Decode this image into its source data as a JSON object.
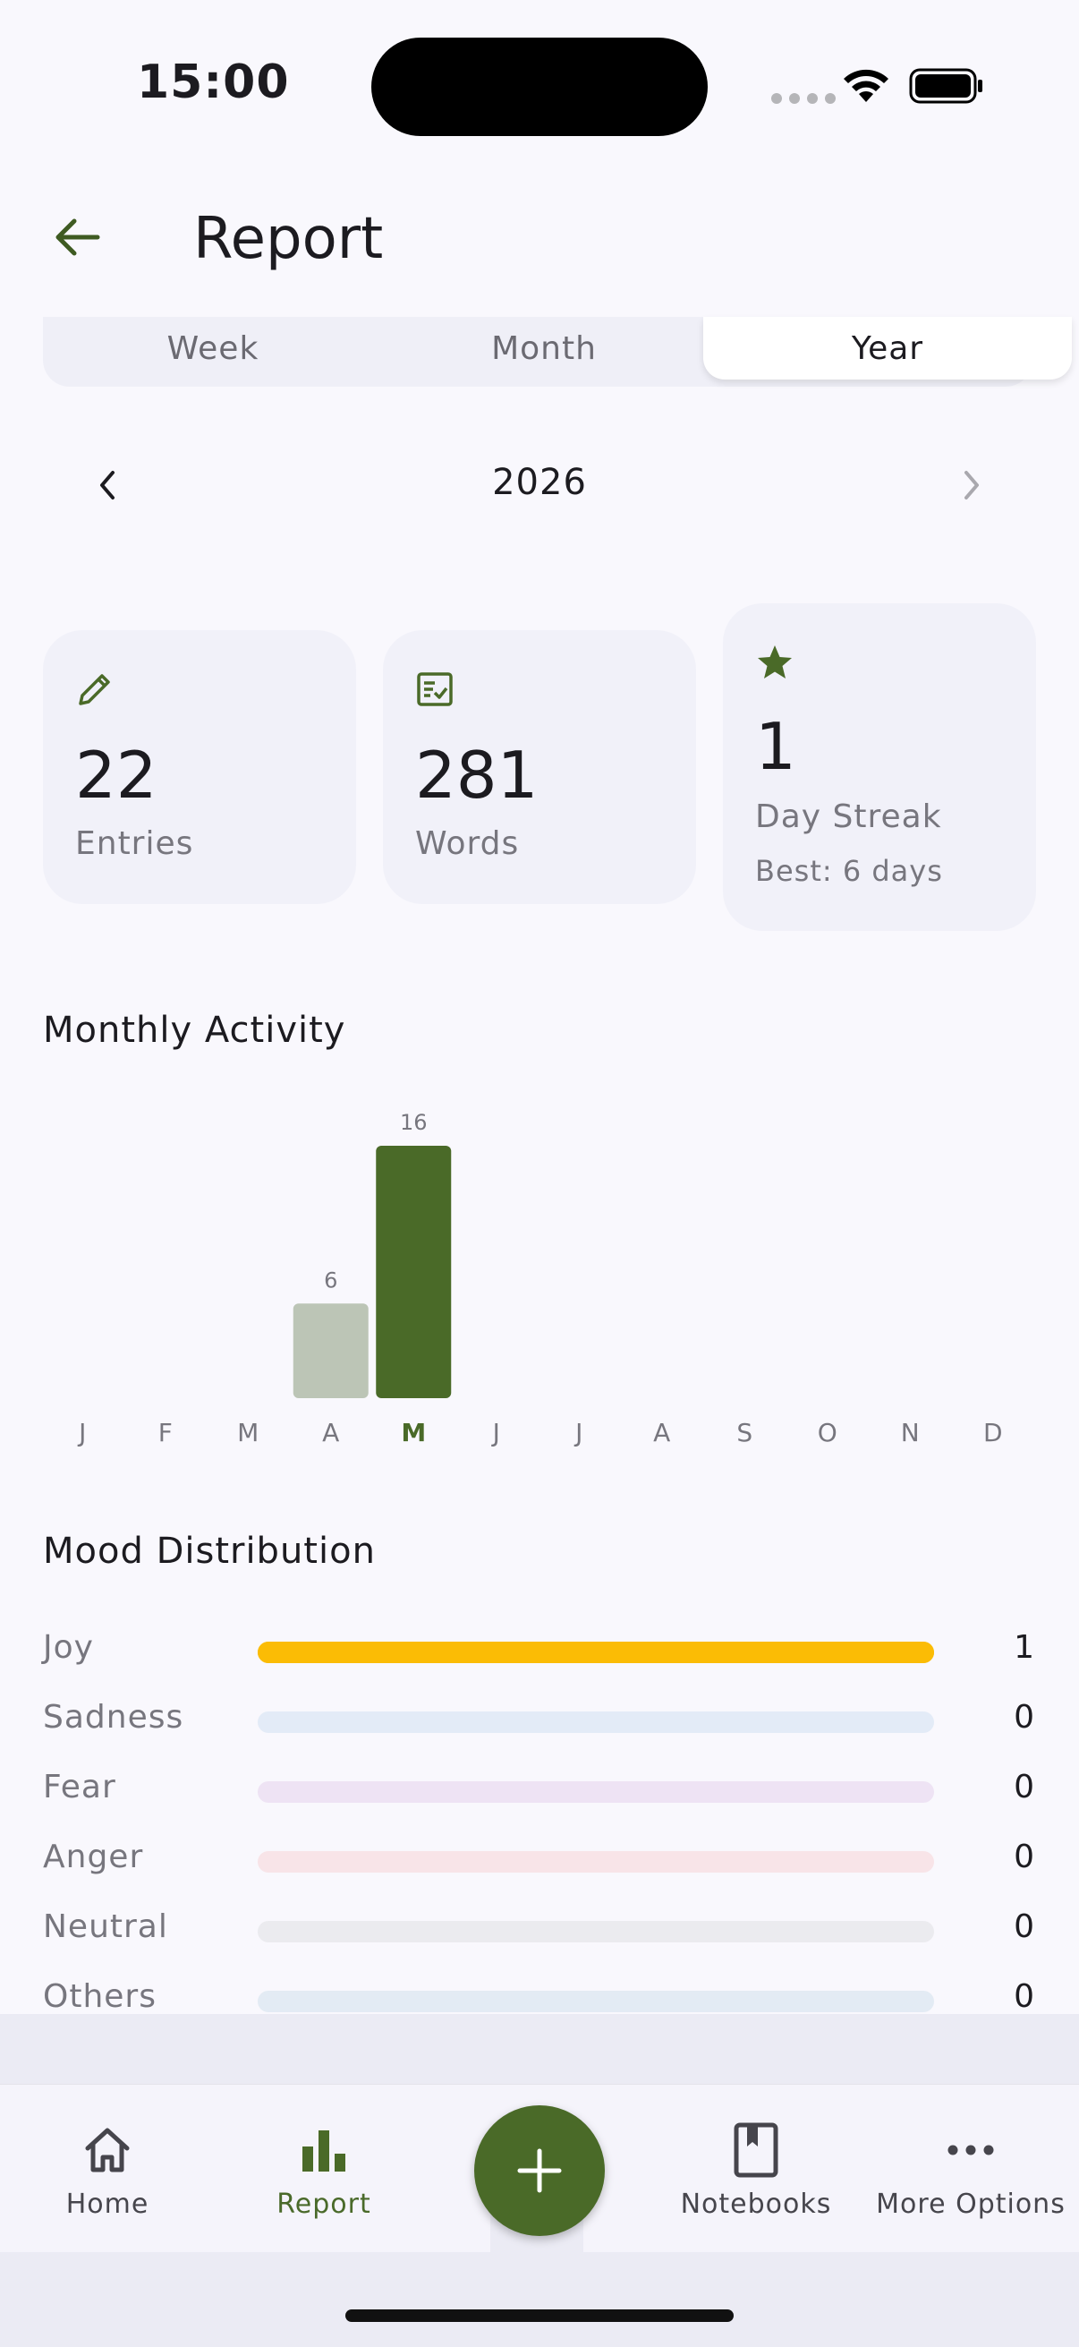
{
  "status_bar": {
    "time": "15:00"
  },
  "header": {
    "title": "Report"
  },
  "period_tabs": [
    {
      "label": "Week",
      "selected": false
    },
    {
      "label": "Month",
      "selected": false
    },
    {
      "label": "Year",
      "selected": true
    }
  ],
  "year_nav": {
    "label": "2026"
  },
  "stats": {
    "entries": {
      "value": "22",
      "label": "Entries",
      "icon": "pencil-icon"
    },
    "words": {
      "value": "281",
      "label": "Words",
      "icon": "checklist-icon"
    },
    "streak": {
      "value": "1",
      "label": "Day Streak",
      "sub": "Best: 6 days",
      "icon": "star-icon"
    }
  },
  "sections": {
    "activity_title": "Monthly Activity",
    "mood_title": "Mood Distribution"
  },
  "chart_data": {
    "type": "bar",
    "categories": [
      "J",
      "F",
      "M",
      "A",
      "M",
      "J",
      "J",
      "A",
      "S",
      "O",
      "N",
      "D"
    ],
    "values": [
      0,
      0,
      0,
      6,
      16,
      0,
      0,
      0,
      0,
      0,
      0,
      0
    ],
    "value_labels": [
      "",
      "",
      "",
      "6",
      "16",
      "",
      "",
      "",
      "",
      "",
      "",
      ""
    ],
    "highlight_index": 4,
    "ylim": [
      0,
      16
    ],
    "colors": {
      "highlight": "#4a6a28",
      "normal": "#bcc5b6",
      "label": "#77767e"
    }
  },
  "moods": [
    {
      "label": "Joy",
      "count": "1",
      "fraction": 1.0,
      "color": "#fbbc05",
      "track": "#fbbc05"
    },
    {
      "label": "Sadness",
      "count": "0",
      "fraction": 0,
      "color": "#5d8bd6",
      "track": "#e3ebf7"
    },
    {
      "label": "Fear",
      "count": "0",
      "fraction": 0,
      "color": "#9a5cc8",
      "track": "#eee3f4"
    },
    {
      "label": "Anger",
      "count": "0",
      "fraction": 0,
      "color": "#e06666",
      "track": "#f8e4e8"
    },
    {
      "label": "Neutral",
      "count": "0",
      "fraction": 0,
      "color": "#9e9e9e",
      "track": "#ebebef"
    },
    {
      "label": "Others",
      "count": "0",
      "fraction": 0,
      "color": "#5d8bd6",
      "track": "#e3ebf4"
    }
  ],
  "bottom_nav": {
    "home": "Home",
    "report": "Report",
    "notebooks": "Notebooks",
    "more": "More Options"
  }
}
